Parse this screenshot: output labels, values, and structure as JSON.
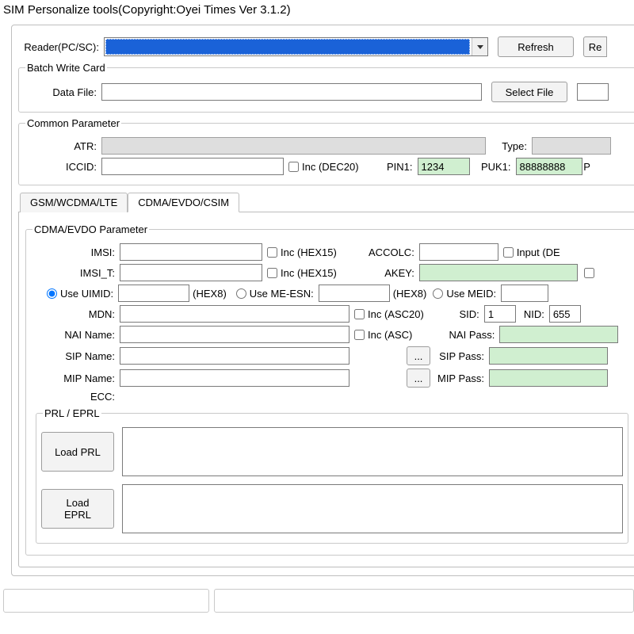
{
  "window_title": "SIM Personalize tools(Copyright:Oyei Times Ver 3.1.2)",
  "reader_label": "Reader(PC/SC):",
  "refresh_label": "Refresh",
  "re_label": "Re",
  "batch": {
    "legend": "Batch Write Card",
    "data_file_label": "Data File:",
    "data_file_value": "",
    "select_file_label": "Select File"
  },
  "common": {
    "legend": "Common Parameter",
    "atr_label": "ATR:",
    "atr_value": "",
    "type_label": "Type:",
    "type_value": "",
    "iccid_label": "ICCID:",
    "iccid_value": "",
    "inc_dec20_label": "Inc  (DEC20)",
    "pin1_label": "PIN1:",
    "pin1_value": "1234",
    "puk1_label": "PUK1:",
    "puk1_value": "88888888",
    "p_label": "P"
  },
  "tabs": {
    "gsm": "GSM/WCDMA/LTE",
    "cdma": "CDMA/EVDO/CSIM"
  },
  "cdma": {
    "legend": "CDMA/EVDO Parameter",
    "imsi_label": "IMSI:",
    "imsi_value": "",
    "inc_hex15_label": "Inc  (HEX15)",
    "accolc_label": "ACCOLC:",
    "accolc_value": "",
    "input_de_label": "Input  (DE",
    "imsi_t_label": "IMSI_T:",
    "imsi_t_value": "",
    "akey_label": "AKEY:",
    "akey_value": "",
    "use_uimid_label": "Use UIMID:",
    "uimid_value": "",
    "hex8_label": "(HEX8)",
    "use_me_esn_label": "Use ME-ESN:",
    "me_esn_value": "",
    "use_meid_label": "Use MEID:",
    "meid_value": "",
    "mdn_label": "MDN:",
    "mdn_value": "",
    "inc_asc20_label": "Inc  (ASC20)",
    "sid_label": "SID:",
    "sid_value": "1",
    "nid_label": "NID:",
    "nid_value": "655",
    "nai_name_label": "NAI Name:",
    "nai_name_value": "",
    "inc_asc_label": "Inc  (ASC)",
    "nai_pass_label": "NAI Pass:",
    "nai_pass_value": "",
    "sip_name_label": "SIP Name:",
    "sip_name_value": "",
    "sip_pass_label": "SIP Pass:",
    "sip_pass_value": "",
    "mip_name_label": "MIP Name:",
    "mip_name_value": "",
    "mip_pass_label": "MIP Pass:",
    "mip_pass_value": "",
    "ecc_label": "ECC:",
    "ellipsis": "...",
    "prl": {
      "legend": "PRL / EPRL",
      "load_prl": "Load PRL",
      "load_eprl": "Load EPRL"
    }
  }
}
